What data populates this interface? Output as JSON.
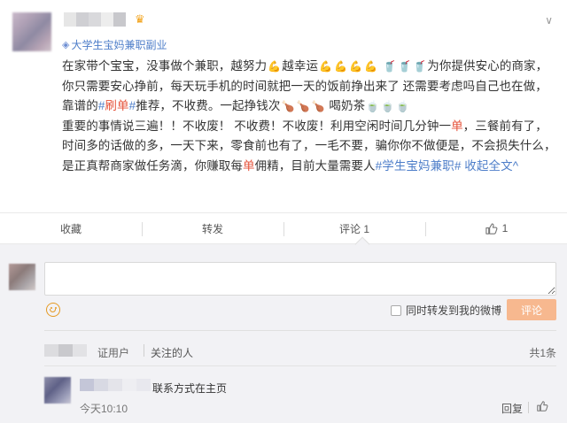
{
  "post": {
    "source_label": "大学生宝妈兼职副业",
    "more_icon": "chevron-down-icon",
    "body": [
      {
        "t": "在家带个宝宝，没事做个兼职，越努力"
      },
      {
        "emo": "arm",
        "g": "💪"
      },
      {
        "t": "越幸运"
      },
      {
        "emo": "arm",
        "g": "💪"
      },
      {
        "emo": "arm",
        "g": "💪"
      },
      {
        "emo": "arm",
        "g": "💪"
      },
      {
        "emo": "arm",
        "g": "💪"
      },
      {
        "t": " "
      },
      {
        "emo": "cup",
        "g": "🥤"
      },
      {
        "emo": "cup",
        "g": "🥤"
      },
      {
        "emo": "cup",
        "g": "🥤"
      },
      {
        "t": "为你提供安心的商家，你只需要安心挣前，每天玩手机的时间就把一天的饭前挣出来了 还需要考虑吗自己也在做，靠谱的"
      },
      {
        "tag": "#"
      },
      {
        "hl": "刷单"
      },
      {
        "tag": "#"
      },
      {
        "t": "推荐，不收费。一起挣钱次"
      },
      {
        "emo": "leg",
        "g": "🍗"
      },
      {
        "emo": "leg",
        "g": "🍗"
      },
      {
        "emo": "leg",
        "g": "🍗"
      },
      {
        "t": " 喝奶茶"
      },
      {
        "emo": "bowl",
        "g": "🍵"
      },
      {
        "emo": "bowl",
        "g": "🍵"
      },
      {
        "emo": "bowl",
        "g": "🍵"
      },
      {
        "br": true
      },
      {
        "t": "重要的事情说三遍！！不收废！ 不收费！不收废！利用空闲时间几分钟一"
      },
      {
        "hl": "单"
      },
      {
        "t": "，三餐前有了，时间多的话做的多，一天下来，零食前也有了，一毛不要，骗你你不做便是，不会损失什么，是正真帮商家做任务滴，你赚取每"
      },
      {
        "hl": "单"
      },
      {
        "t": "佣精，目前大量需要人"
      },
      {
        "tag": "#学生宝妈兼职#"
      },
      {
        "t": " "
      },
      {
        "link": "收起全文^"
      }
    ]
  },
  "actions": {
    "collect": "收藏",
    "repost": "转发",
    "comment": "评论 1",
    "like_icon": "thumbs-up-icon",
    "like_count": "1"
  },
  "composer": {
    "placeholder": "",
    "emoji_icon": "smiley-icon",
    "repost_checkbox_label": "同时转发到我的微博",
    "repost_checked": false,
    "submit_label": "评论"
  },
  "comments": {
    "filter_partial": "证用户",
    "filter_following": "关注的人",
    "total": "共1条",
    "items": [
      {
        "text": "联系方式在主页",
        "time": "今天10:10",
        "reply_label": "回复",
        "like_icon": "thumbs-up-icon"
      }
    ]
  },
  "colors": {
    "link": "#4e7ec9",
    "highlight": "#e5533b",
    "submit_bg": "#f7b88f",
    "panel_bg": "#f2f2f5"
  }
}
